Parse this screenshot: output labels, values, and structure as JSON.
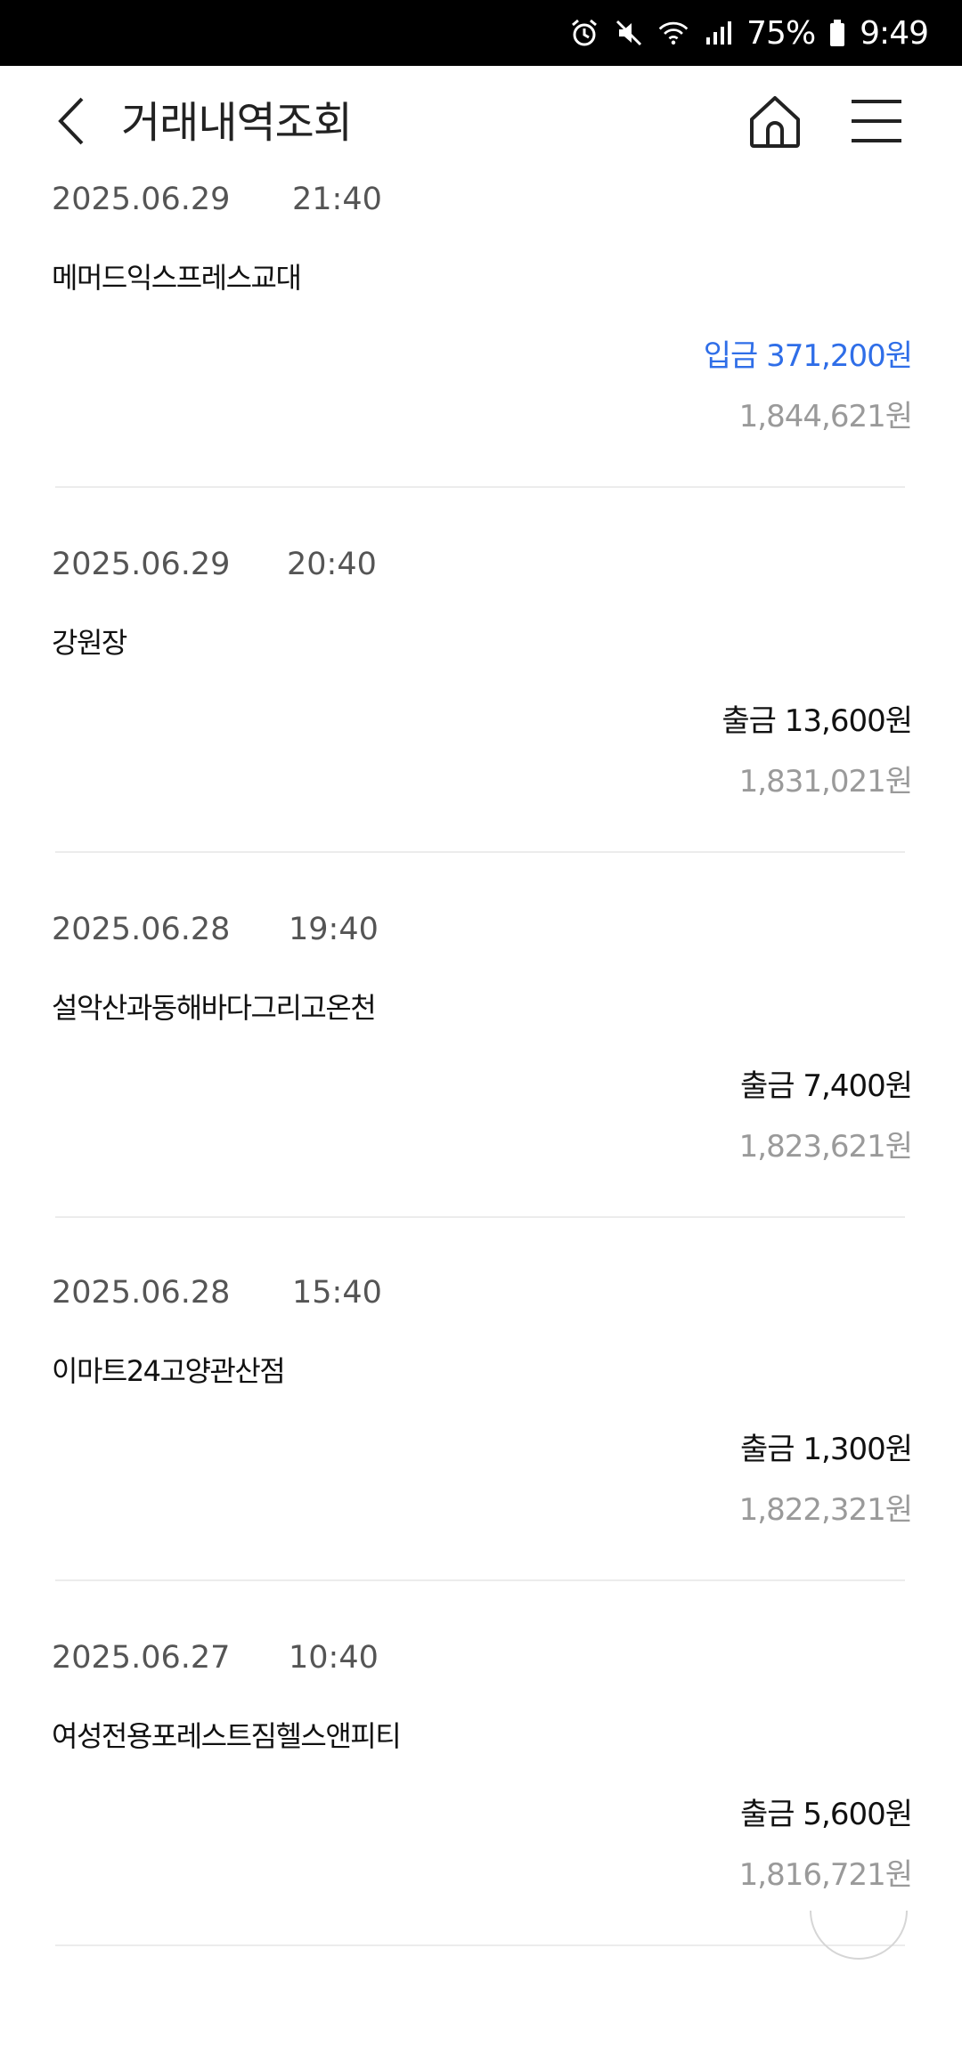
{
  "status_bar": {
    "battery": "75%",
    "time": "9:49",
    "icons": [
      "alarm-icon",
      "mute-icon",
      "wifi-icon",
      "signal-icon",
      "battery-icon"
    ]
  },
  "header": {
    "title": "거래내역조회",
    "back_icon": "chevron-left-icon",
    "home_icon": "home-icon",
    "menu_icon": "hamburger-menu-icon"
  },
  "transactions": [
    {
      "date": "2025.06.29",
      "time": "21:40",
      "merchant": "메머드익스프레스교대",
      "amount": "입금 371,200원",
      "type": "deposit",
      "balance": "1,844,621원"
    },
    {
      "date": "2025.06.29",
      "time": "20:40",
      "merchant": "강원장",
      "amount": "출금 13,600원",
      "type": "withdraw",
      "balance": "1,831,021원"
    },
    {
      "date": "2025.06.28",
      "time": "19:40",
      "merchant": "설악산과동해바다그리고온천",
      "amount": "출금 7,400원",
      "type": "withdraw",
      "balance": "1,823,621원"
    },
    {
      "date": "2025.06.28",
      "time": "15:40",
      "merchant": "이마트24고양관산점",
      "amount": "출금 1,300원",
      "type": "withdraw",
      "balance": "1,822,321원"
    },
    {
      "date": "2025.06.27",
      "time": "10:40",
      "merchant": "여성전용포레스트짐헬스앤피티",
      "amount": "출금 5,600원",
      "type": "withdraw",
      "balance": "1,816,721원"
    }
  ],
  "colors": {
    "deposit": "#2f6ee8",
    "withdraw": "#111111",
    "balance": "#9a9a9a",
    "divider": "#ececec"
  }
}
